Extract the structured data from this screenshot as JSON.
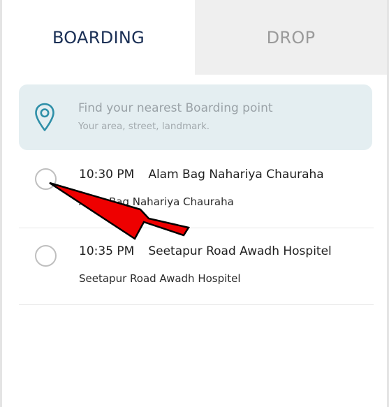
{
  "tabs": {
    "boarding": "BOARDING",
    "drop": "DROP"
  },
  "search": {
    "placeholder": "Find your nearest Boarding point",
    "hint": "Your area, street, landmark."
  },
  "points": [
    {
      "time": "10:30 PM",
      "name": "Alam Bag Nahariya Chauraha",
      "address": "Alam Bag Nahariya Chauraha",
      "selected": false
    },
    {
      "time": "10:35 PM",
      "name": "Seetapur Road Awadh Hospitel",
      "address": "Seetapur Road Awadh Hospitel",
      "selected": false
    }
  ],
  "colors": {
    "active_tab_text": "#1a2f55",
    "inactive_tab_text": "#9a9a9a",
    "inactive_tab_bg": "#efefef",
    "search_bg": "#e4eef1",
    "pin_icon": "#2e8fa8",
    "annotation_arrow": "#ee0000"
  },
  "icons": {
    "search": "location-pin-icon",
    "annotation": "red-arrow-pointer"
  }
}
